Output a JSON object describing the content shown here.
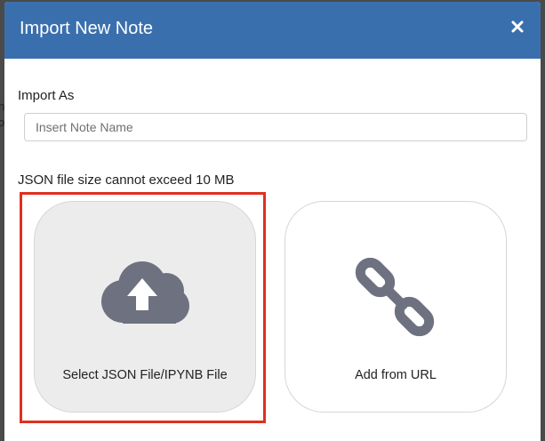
{
  "modal": {
    "title": "Import New Note",
    "close_label": "×"
  },
  "form": {
    "import_as_label": "Import As",
    "note_name_placeholder": "Insert Note Name",
    "note_name_value": "",
    "size_note": "JSON file size cannot exceed 10 MB"
  },
  "options": [
    {
      "label": "Select JSON File/IPYNB File",
      "icon": "cloud-upload-icon",
      "selected": true
    },
    {
      "label": "Add from URL",
      "icon": "link-icon",
      "selected": false
    }
  ],
  "colors": {
    "header": "#3a6fae",
    "icon": "#6e7180",
    "highlight": "#e0301e",
    "selected_card": "#ececec"
  }
}
